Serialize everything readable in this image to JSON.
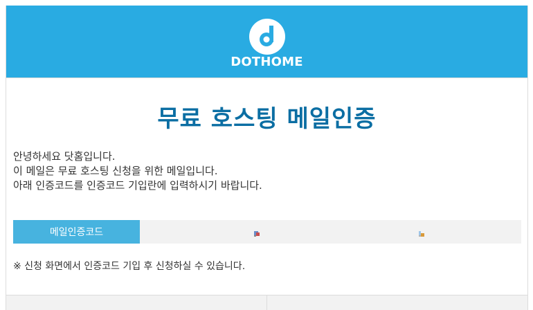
{
  "header": {
    "brand": "DOTHOME",
    "brand_color": "#29abe2",
    "logo_icon": "dothome-logo-icon"
  },
  "content": {
    "title": "무료 호스팅 메일인증",
    "intro_lines": [
      "안녕하세요 닷홈입니다.",
      "이 메일은 무료 호스팅 신청을 위한 메일입니다.",
      "아래 인증코드를 인증코드 기입란에 입력하시기 바랍니다."
    ],
    "code_label": "메일인증코드",
    "code_icons": [
      "broken-image-icon",
      "broken-image-icon"
    ],
    "note": "※ 신청 화면에서 인증코드 기입 후 신청하실 수 있습니다."
  }
}
